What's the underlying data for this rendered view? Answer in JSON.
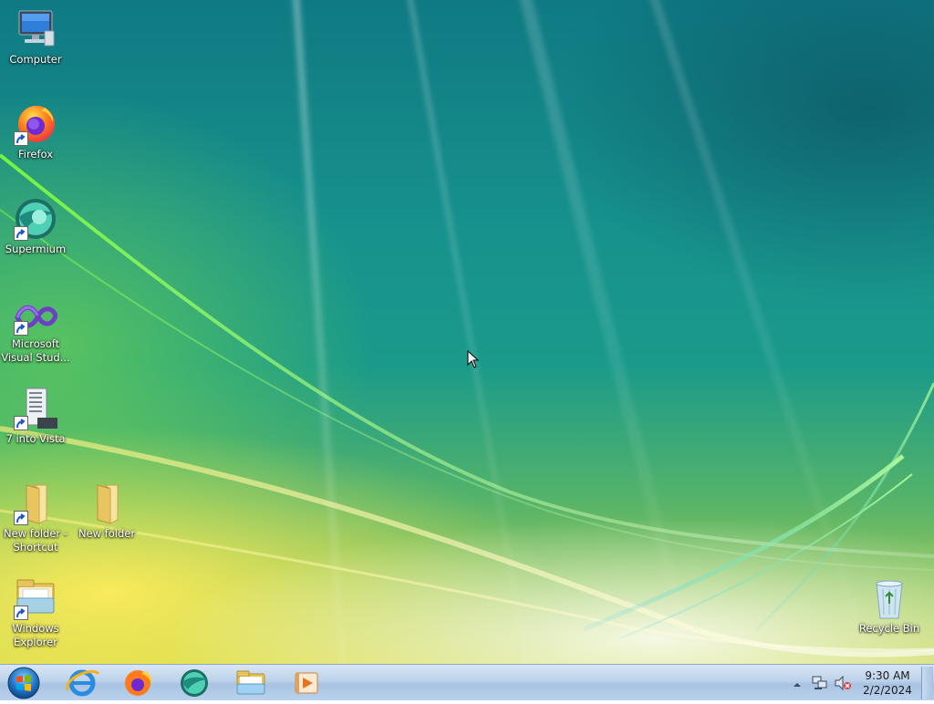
{
  "desktop": {
    "icons": [
      {
        "label": "Computer",
        "icon": "computer-icon",
        "shortcut": false
      },
      {
        "label": "Firefox",
        "icon": "firefox-icon",
        "shortcut": true
      },
      {
        "label": "Supermium",
        "icon": "supermium-icon",
        "shortcut": true
      },
      {
        "label": "Microsoft Visual Stud...",
        "icon": "visual-studio-icon",
        "shortcut": true
      },
      {
        "label": "7 into Vista",
        "icon": "7-into-vista-icon",
        "shortcut": true
      },
      {
        "label": "New folder - Shortcut",
        "icon": "folder-icon",
        "shortcut": true
      },
      {
        "label": "New folder",
        "icon": "folder-icon",
        "shortcut": false
      },
      {
        "label": "Windows Explorer",
        "icon": "windows-explorer-icon",
        "shortcut": true
      },
      {
        "label": "Recycle Bin",
        "icon": "recycle-bin-icon",
        "shortcut": false
      }
    ]
  },
  "taskbar": {
    "start": {
      "icon": "start-orb-icon"
    },
    "pinned": [
      {
        "name": "Internet Explorer",
        "icon": "internet-explorer-icon"
      },
      {
        "name": "Firefox",
        "icon": "firefox-icon"
      },
      {
        "name": "Supermium",
        "icon": "supermium-icon"
      },
      {
        "name": "Windows Explorer",
        "icon": "windows-explorer-icon"
      },
      {
        "name": "Windows Media Player",
        "icon": "media-player-icon"
      }
    ],
    "tray": {
      "icons": [
        "show-hidden-icons-icon",
        "network-icon",
        "volume-muted-icon"
      ],
      "time": "9:30 AM",
      "date": "2/2/2024"
    }
  },
  "colors": {
    "taskbar_top": "#d9e6f4",
    "taskbar_bottom": "#a8c3e2",
    "wallpaper_teal": "#17928d",
    "wallpaper_yellow": "#c9d74a"
  }
}
